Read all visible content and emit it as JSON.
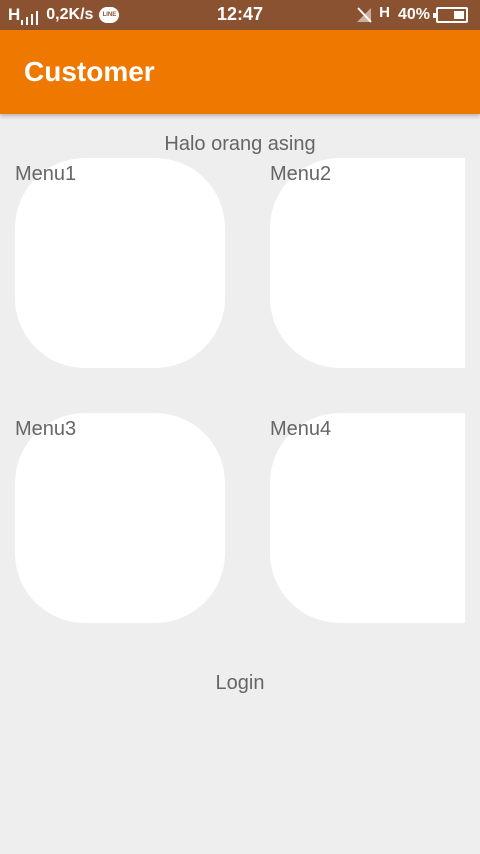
{
  "status_bar": {
    "signal_text": "H",
    "net_speed": "0,2K/s",
    "line_badge": "LINE",
    "clock": "12:47",
    "network_type": "H",
    "battery_percent": "40%",
    "battery_level": 0.4,
    "icons": [
      "signal-icon",
      "line-icon",
      "mute-icon",
      "battery-icon"
    ]
  },
  "app_bar": {
    "title": "Customer",
    "color": "#ef7800"
  },
  "main": {
    "greeting": "Halo orang asing",
    "menus": [
      {
        "label": "Menu1"
      },
      {
        "label": "Menu2"
      },
      {
        "label": "Menu3"
      },
      {
        "label": "Menu4"
      }
    ],
    "login_label": "Login"
  },
  "colors": {
    "status_bar": "#8a5230",
    "background": "#eeeeee",
    "card": "#ffffff",
    "text": "#666666"
  }
}
